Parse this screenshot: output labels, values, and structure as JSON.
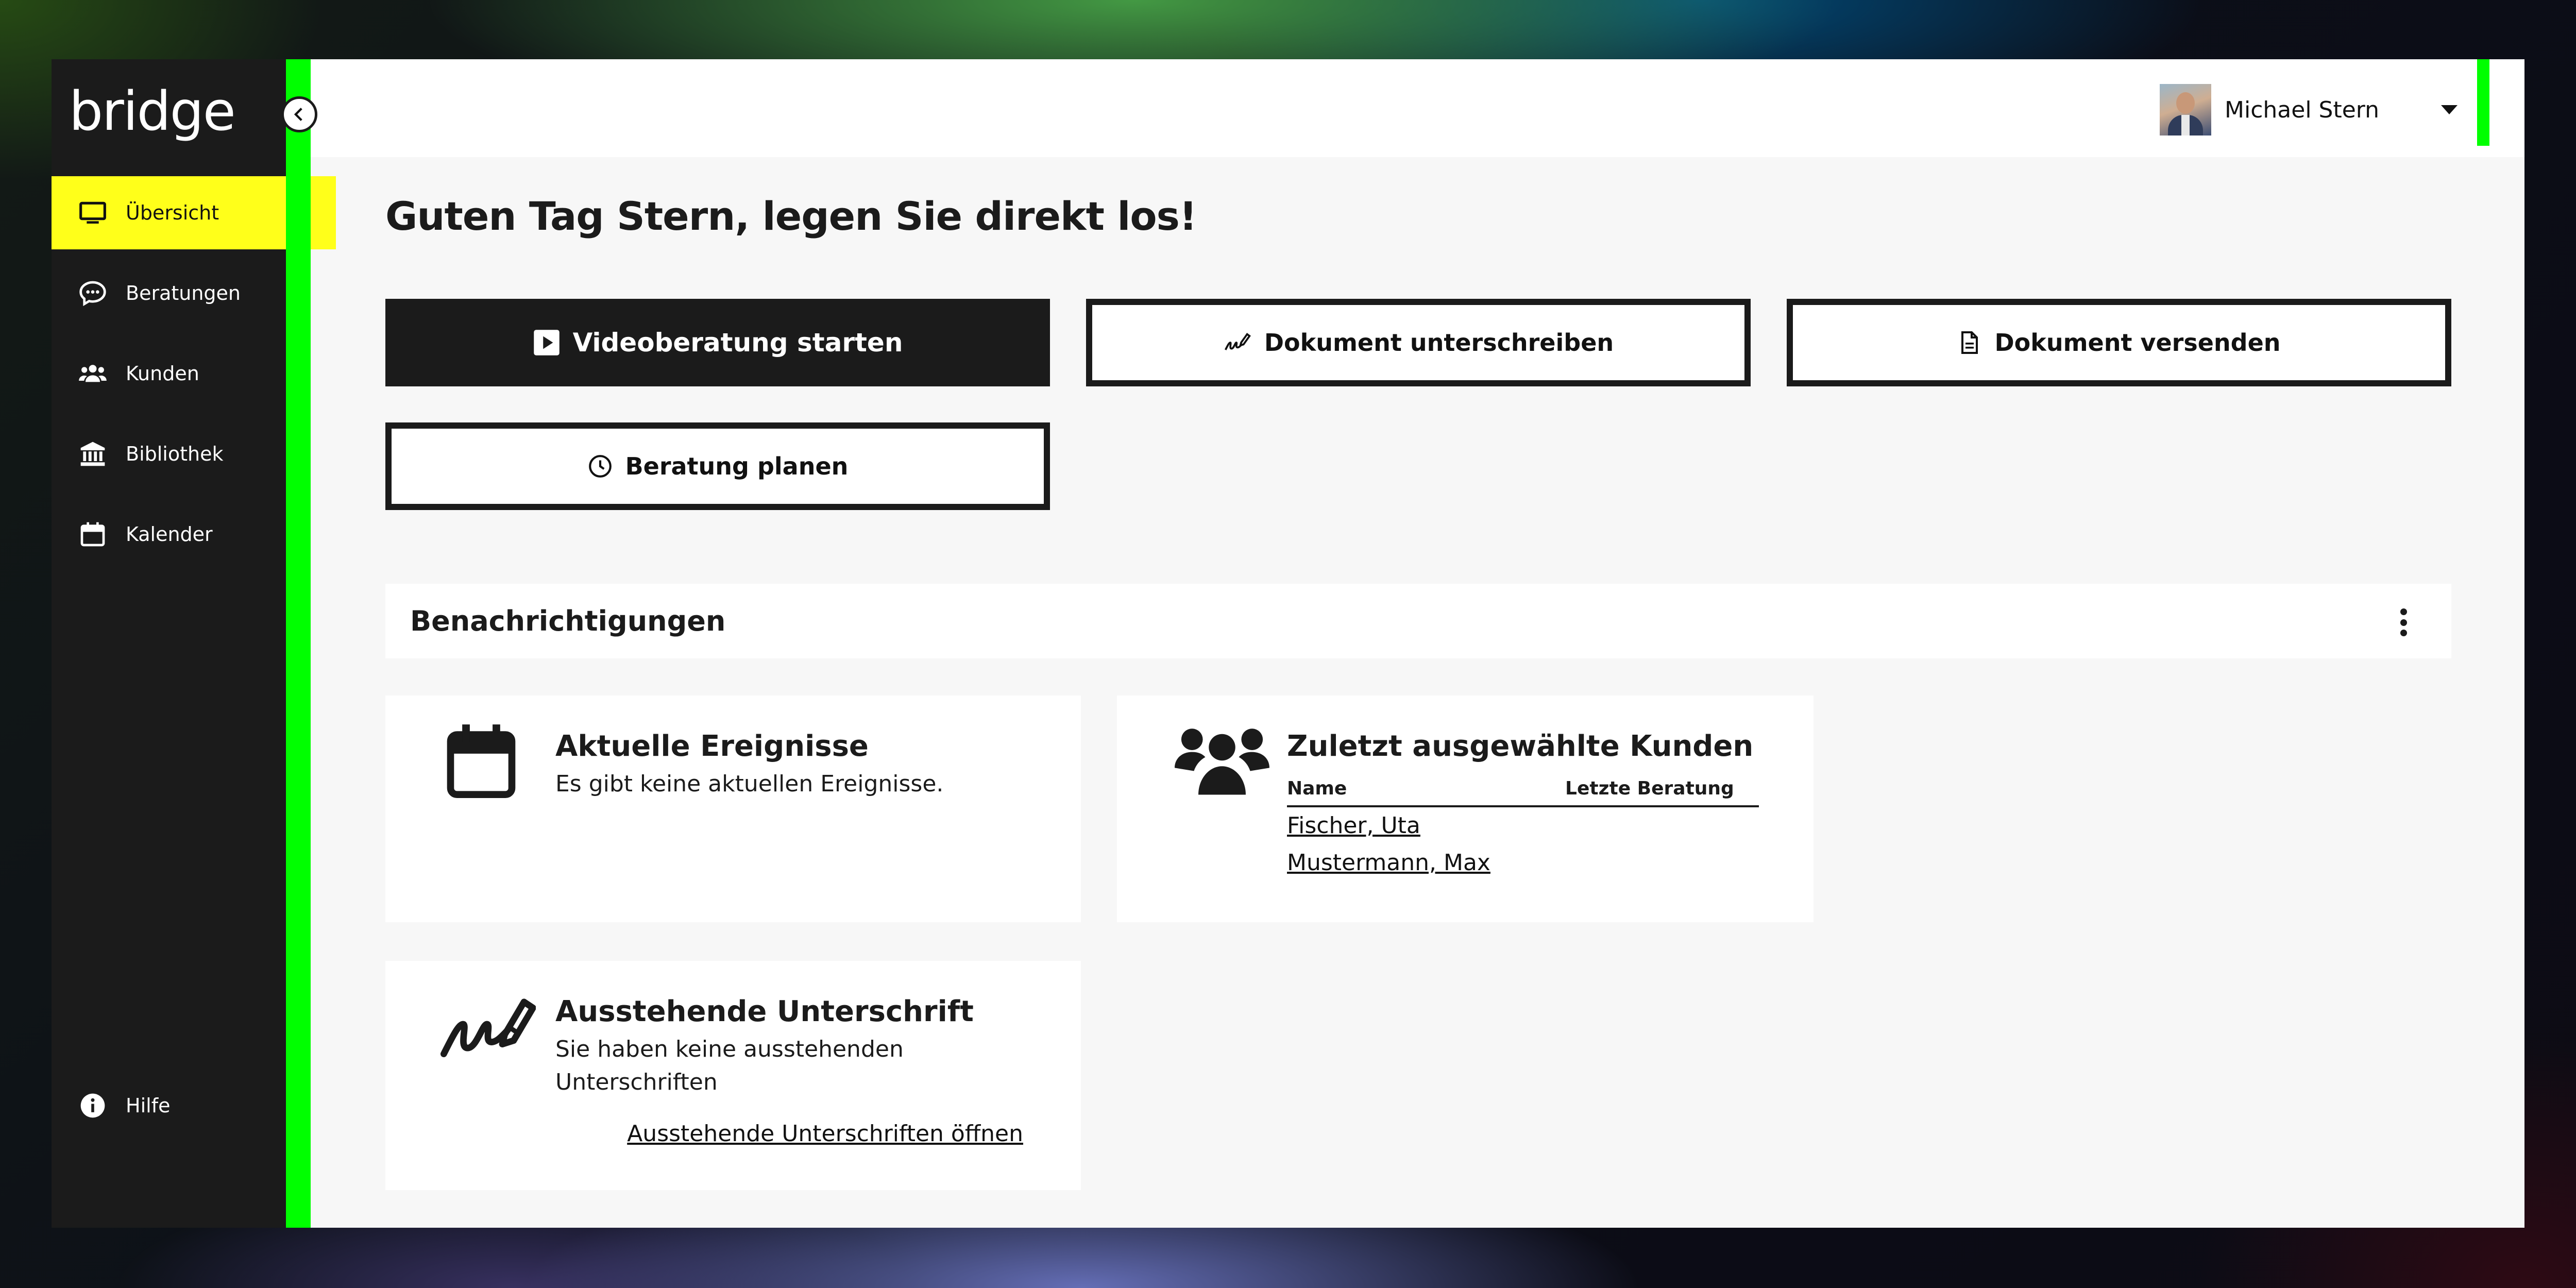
{
  "app": {
    "logo": "bridge"
  },
  "sidebar": {
    "items": [
      {
        "label": "Übersicht",
        "icon": "monitor-icon",
        "active": true
      },
      {
        "label": "Beratungen",
        "icon": "chat-bubble-icon"
      },
      {
        "label": "Kunden",
        "icon": "users-icon"
      },
      {
        "label": "Bibliothek",
        "icon": "bank-icon"
      },
      {
        "label": "Kalender",
        "icon": "calendar-icon"
      }
    ],
    "help": {
      "label": "Hilfe",
      "icon": "info-icon"
    }
  },
  "header": {
    "user_name": "Michael Stern"
  },
  "main": {
    "greeting": "Guten Tag Stern, legen Sie direkt los!",
    "actions": [
      {
        "label": "Videoberatung starten",
        "icon": "play-icon"
      },
      {
        "label": "Dokument unterschreiben",
        "icon": "signature-icon"
      },
      {
        "label": "Dokument versenden",
        "icon": "document-icon"
      },
      {
        "label": "Beratung planen",
        "icon": "clock-icon"
      }
    ],
    "notifications_title": "Benachrichtigungen",
    "events_card": {
      "title": "Aktuelle Ereignisse",
      "text": "Es gibt keine aktuellen Ereignisse."
    },
    "customers_card": {
      "title": "Zuletzt ausgewählte Kunden",
      "columns": [
        "Name",
        "Letzte Beratung"
      ],
      "rows": [
        "Fischer, Uta",
        "Mustermann, Max"
      ]
    },
    "signature_card": {
      "title": "Ausstehende Unterschrift",
      "text_line1": "Sie haben keine ausstehenden",
      "text_line2": "Unterschriften",
      "link": "Ausstehende Unterschriften öffnen"
    }
  },
  "colors": {
    "accent_yellow": "#ffff1a",
    "accent_green": "#00ff00",
    "sidebar_bg": "#1b1b1b",
    "content_bg": "#f7f7f7"
  }
}
